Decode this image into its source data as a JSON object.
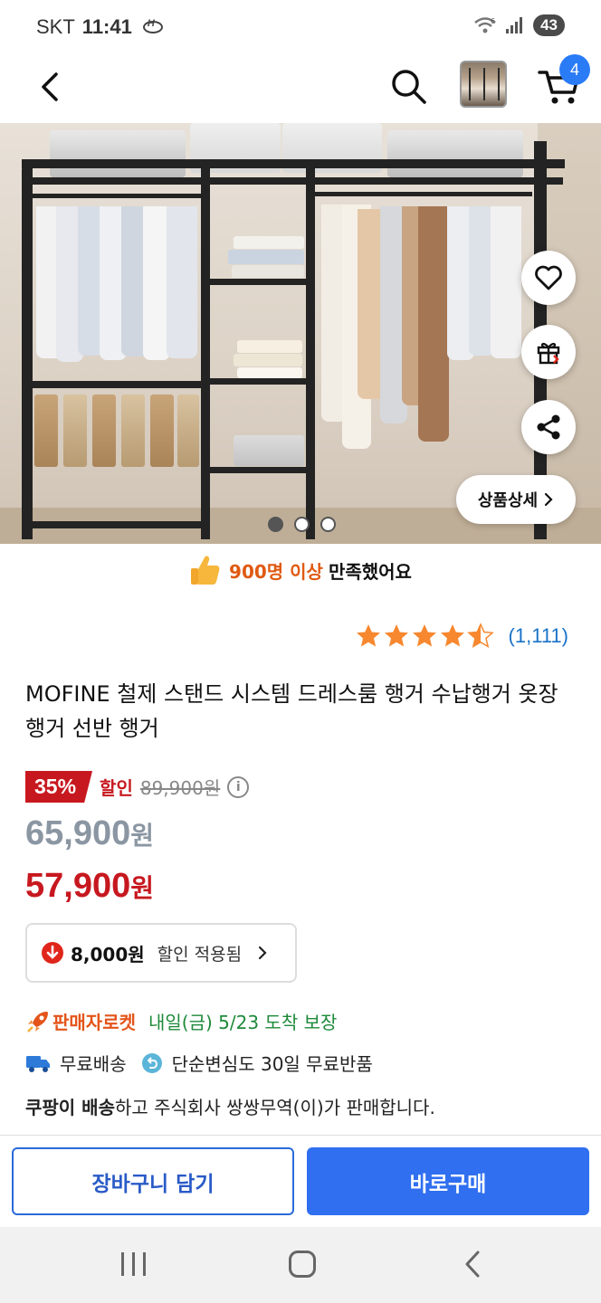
{
  "status": {
    "carrier": "SKT",
    "time": "11:41",
    "battery": "43"
  },
  "appbar": {
    "cart_count": "4"
  },
  "hero": {
    "detail_label": "상품상세",
    "dots": [
      true,
      false,
      false
    ]
  },
  "satisfaction": {
    "highlight": "900명 이상",
    "text": "만족했어요"
  },
  "rating": {
    "stars": 4.5,
    "count": "(1,111)"
  },
  "product": {
    "title": "MOFINE 철제 스탠드 시스템 드레스룸 행거 수납행거 옷장행거 선반 행거"
  },
  "price": {
    "discount_rate": "35%",
    "discount_label": "할인",
    "original": "89,900원",
    "sale_amount": "65,900",
    "final_amount": "57,900",
    "currency": "원"
  },
  "coupon": {
    "amount": "8,000원",
    "label": "할인 적용됨"
  },
  "delivery": {
    "brand": "판매자로켓",
    "eta": "내일(금) 5/23 도착 보장",
    "free_shipping": "무료배송",
    "free_return": "단순변심도 30일 무료반품"
  },
  "seller": {
    "bold": "쿠팡이 배송",
    "rest": "하고 주식회사 쌍쌍무역(이)가 판매합니다."
  },
  "actions": {
    "cart_label": "장바구니 담기",
    "buy_label": "바로구매"
  },
  "colors": {
    "accent": "#2f6ff0",
    "discount": "#c7181f",
    "rocket": "#e4541a",
    "eta": "#1e8a3a",
    "rating": "#1a73c9",
    "star": "#f7882f"
  }
}
